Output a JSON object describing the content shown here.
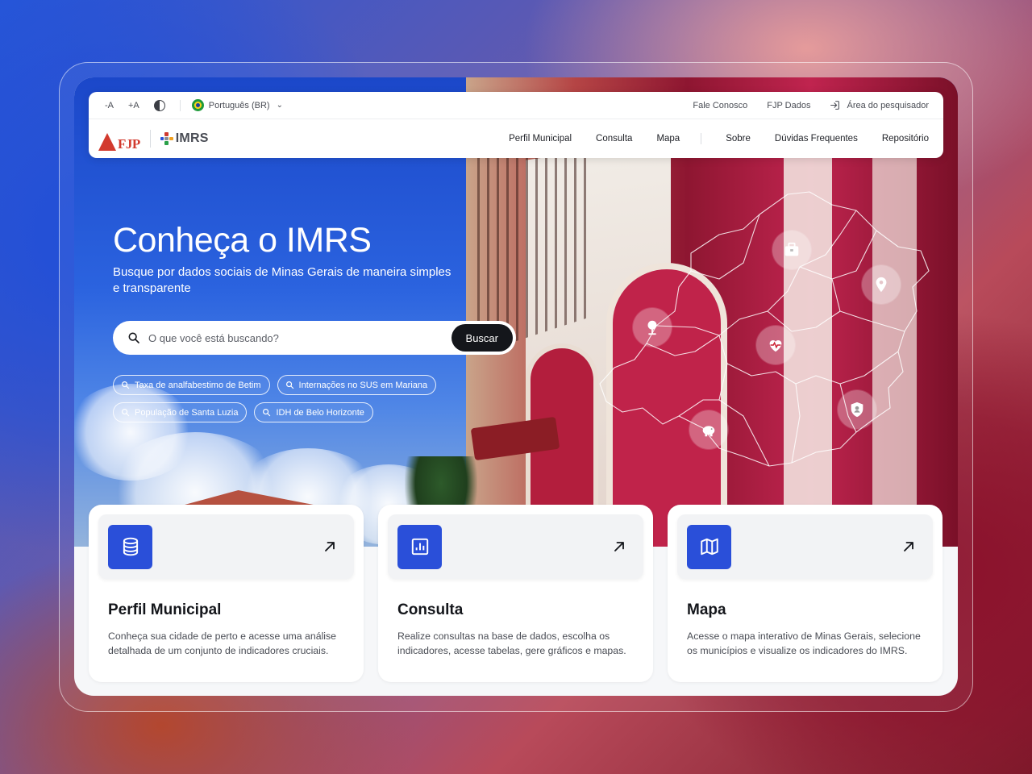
{
  "topbar": {
    "font_decrease": "-A",
    "font_increase": "+A",
    "language": "Português (BR)",
    "links": [
      "Fale Conosco",
      "FJP Dados"
    ],
    "login_label": "Área do pesquisador"
  },
  "brand": {
    "fjp": "FJP",
    "imrs": "IMRS"
  },
  "nav": {
    "items": [
      "Perfil Municipal",
      "Consulta",
      "Mapa",
      "Sobre",
      "Dúvidas Frequentes",
      "Repositório"
    ]
  },
  "hero": {
    "title": "Conheça o IMRS",
    "subtitle": "Busque por dados sociais de Minas Gerais de maneira simples e transparente",
    "search_placeholder": "O que você está buscando?",
    "search_button": "Buscar",
    "suggestions": [
      "Taxa de analfabestimo de Betim",
      "Internações no SUS em Mariana",
      "População de Santa Luzia",
      "IDH de Belo Horizonte"
    ],
    "map_icons": [
      "briefcase-icon",
      "map-pin-icon",
      "tree-icon",
      "heart-pulse-icon",
      "shield-icon",
      "piggy-bank-icon"
    ]
  },
  "cards": [
    {
      "title": "Perfil Municipal",
      "description": "Conheça sua cidade de perto e acesse uma análise detalhada de um conjunto de indicadores cruciais.",
      "icon": "database-icon"
    },
    {
      "title": "Consulta",
      "description": "Realize consultas na base de dados, escolha os indicadores, acesse tabelas, gere gráficos e mapas.",
      "icon": "chart-icon"
    },
    {
      "title": "Mapa",
      "description": "Acesse o mapa interativo de Minas Gerais, selecione os municípios e visualize os indicadores do IMRS.",
      "icon": "map-icon"
    }
  ],
  "colors": {
    "accent_blue": "#2a4fd9",
    "brand_red": "#d23a2e",
    "button_dark": "#14161b"
  }
}
